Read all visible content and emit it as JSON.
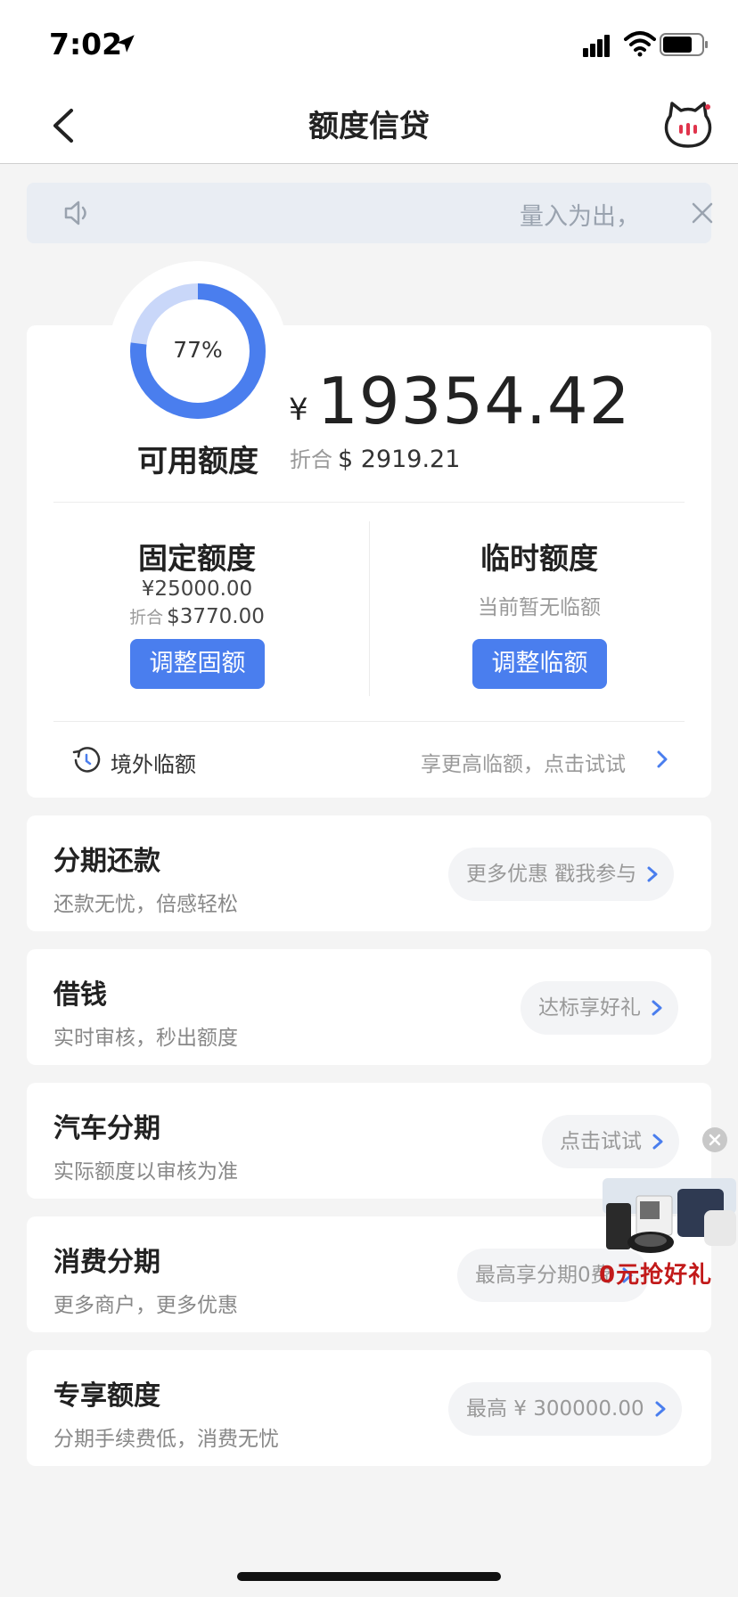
{
  "status_bar": {
    "time": "7:02"
  },
  "nav": {
    "title": "额度信贷"
  },
  "notice": {
    "text": "量入为出，"
  },
  "credit": {
    "usage_percent": 77,
    "usage_label": "77%",
    "available_label": "可用额度",
    "currency_symbol": "¥",
    "available_amount": "19354.42",
    "converted_label": "折合",
    "converted_amount": "$ 2919.21"
  },
  "fixed_limit": {
    "title": "固定额度",
    "amount_cny": "¥25000.00",
    "converted_label": "折合",
    "amount_usd": "$3770.00",
    "button_label": "调整固额"
  },
  "temp_limit": {
    "title": "临时额度",
    "status": "当前暂无临额",
    "button_label": "调整临额"
  },
  "overseas": {
    "label": "境外临额",
    "hint": "享更高临额，点击试试"
  },
  "products": [
    {
      "title": "分期还款",
      "subtitle": "还款无忧，倍感轻松",
      "pill": "更多优惠 戳我参与"
    },
    {
      "title": "借钱",
      "subtitle": "实时审核，秒出额度",
      "pill": "达标享好礼"
    },
    {
      "title": "汽车分期",
      "subtitle": "实际额度以审核为准",
      "pill": "点击试试"
    },
    {
      "title": "消费分期",
      "subtitle": "更多商户，更多优惠",
      "pill": "最高享分期0费"
    },
    {
      "title": "专享额度",
      "subtitle": "分期手续费低，消费无忧",
      "pill": "最高 ¥ 300000.00"
    }
  ],
  "ad": {
    "label": "0元抢好礼"
  },
  "colors": {
    "primary": "#4a7eee",
    "ring_track": "#c9d7f9",
    "background": "#f4f4f4",
    "ad_red": "#c21a1a"
  }
}
